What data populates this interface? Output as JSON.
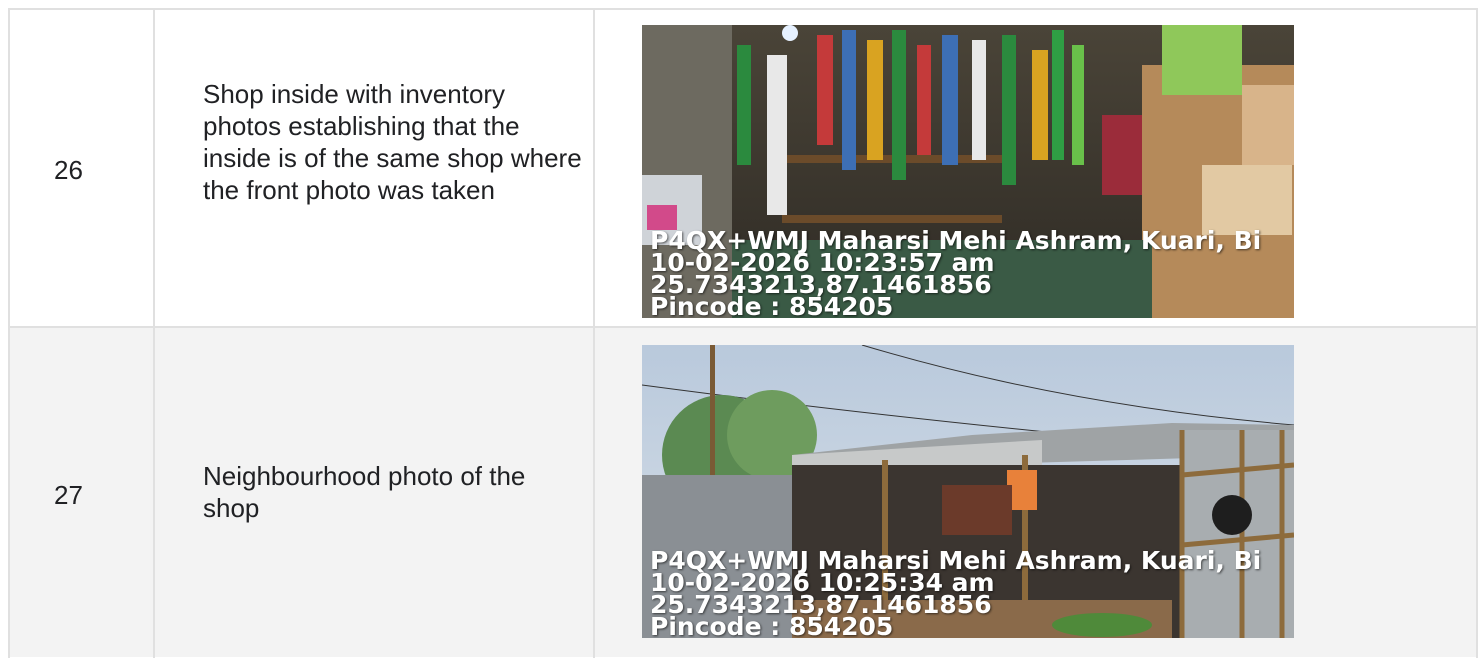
{
  "rows": [
    {
      "number": "26",
      "description": "Shop inside with inventory photos establishing that the inside is of the same shop where the front photo was taken",
      "photo": {
        "subject": "shop-interior-inventory",
        "overlay": [
          "P4QX+WMJ Maharsi Mehi Ashram, Kuari, Bi",
          "10-02-2026 10:23:57 am",
          "25.7343213,87.1461856",
          "Pincode : 854205"
        ]
      }
    },
    {
      "number": "27",
      "description": "Neighbourhood photo of the shop",
      "photo": {
        "subject": "shop-neighbourhood-exterior",
        "overlay": [
          "P4QX+WMJ Maharsi Mehi Ashram, Kuari, Bi",
          "10-02-2026 10:25:34 am",
          "25.7343213,87.1461856",
          "Pincode : 854205"
        ]
      }
    }
  ],
  "colors": {
    "border": "#e0e0e0",
    "alt_row_bg": "#f3f3f3",
    "text": "#202124",
    "overlay_text": "#ffffff"
  }
}
